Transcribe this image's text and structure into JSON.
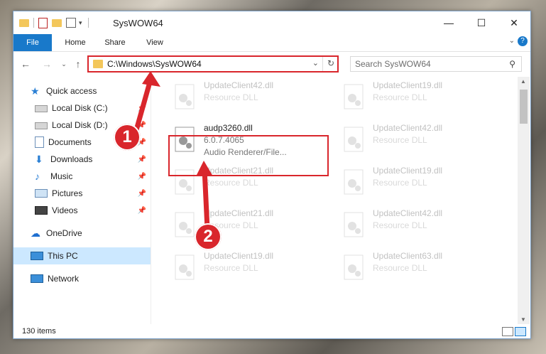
{
  "window": {
    "title": "SysWOW64",
    "controls": {
      "minimize": "—",
      "maximize": "☐",
      "close": "✕"
    }
  },
  "ribbon": {
    "tabs": [
      "File",
      "Home",
      "Share",
      "View"
    ]
  },
  "address": {
    "path": "C:\\Windows\\SysWOW64",
    "search_placeholder": "Search SysWOW64"
  },
  "sidebar": {
    "items": [
      {
        "label": "Quick access",
        "icon": "star-icon"
      },
      {
        "label": "Local Disk (C:)",
        "icon": "drive-icon"
      },
      {
        "label": "Local Disk (D:)",
        "icon": "drive-icon"
      },
      {
        "label": "Documents",
        "icon": "documents-icon"
      },
      {
        "label": "Downloads",
        "icon": "download-icon"
      },
      {
        "label": "Music",
        "icon": "music-icon"
      },
      {
        "label": "Pictures",
        "icon": "pictures-icon"
      },
      {
        "label": "Videos",
        "icon": "videos-icon"
      },
      {
        "label": "OneDrive",
        "icon": "cloud-icon"
      },
      {
        "label": "This PC",
        "icon": "computer-icon"
      },
      {
        "label": "Network",
        "icon": "network-icon"
      }
    ]
  },
  "files": {
    "highlighted": {
      "name": "audp3260.dll",
      "version": "6.0.7.4065",
      "description": "Audio Renderer/File..."
    },
    "left_column": [
      {
        "name": "UpdateClient42.dll",
        "type": "Resource DLL"
      },
      {
        "name": "UpdateClient21.dll",
        "type": "Resource DLL"
      },
      {
        "name": "UpdateClient21.dll",
        "type": "Resource DLL"
      },
      {
        "name": "UpdateClient19.dll",
        "type": "Resource DLL"
      }
    ],
    "right_column": [
      {
        "name": "UpdateClient19.dll",
        "type": "Resource DLL"
      },
      {
        "name": "UpdateClient42.dll",
        "type": "Resource DLL"
      },
      {
        "name": "UpdateClient19.dll",
        "type": "Resource DLL"
      },
      {
        "name": "UpdateClient42.dll",
        "type": "Resource DLL"
      },
      {
        "name": "UpdateClient63.dll",
        "type": "Resource DLL"
      }
    ]
  },
  "status": {
    "item_count": "130 items"
  },
  "annotations": {
    "step1": "1",
    "step2": "2"
  },
  "colors": {
    "accent": "#1979ca",
    "highlight_red": "#d9262c",
    "selection": "#cce8ff"
  }
}
